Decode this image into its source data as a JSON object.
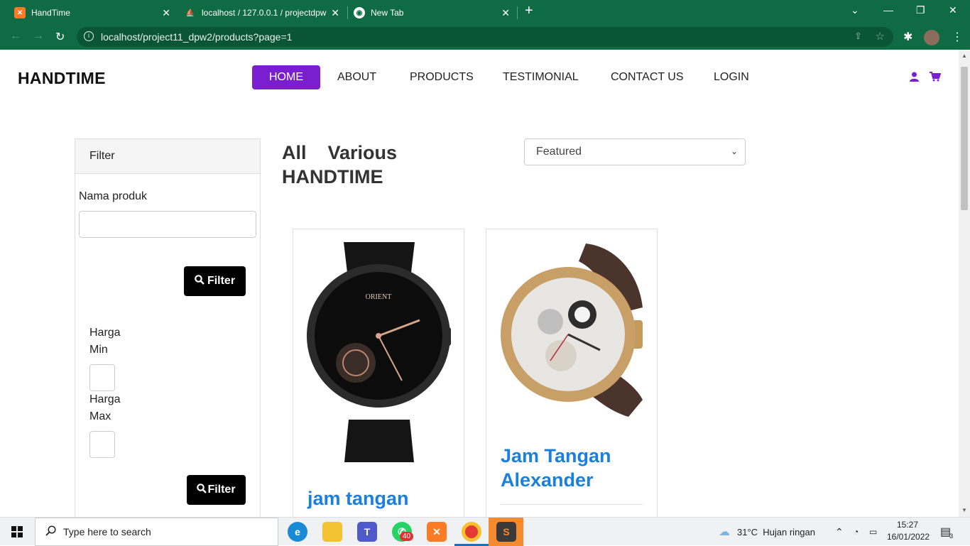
{
  "browser": {
    "tabs": [
      {
        "title": "HandTime",
        "icon": "xampp-icon"
      },
      {
        "title": "localhost / 127.0.0.1 / projectdpw",
        "icon": "phpmyadmin-icon"
      },
      {
        "title": "New Tab",
        "icon": "globe-icon"
      }
    ],
    "new_tab": "+",
    "url": "localhost/project11_dpw2/products?page=1"
  },
  "site": {
    "brand": "HANDTIME",
    "nav": [
      "HOME",
      "ABOUT",
      "PRODUCTS",
      "TESTIMONIAL",
      "CONTACT US",
      "LOGIN"
    ],
    "accent": "#7a1fd0"
  },
  "filter": {
    "title": "Filter",
    "name_label": "Nama produk",
    "name_value": "",
    "filter_button": "Filter",
    "min_label_1": "Harga",
    "min_label_2": "Min",
    "max_label_1": "Harga",
    "max_label_2": "Max",
    "filter_button_2": "Filter"
  },
  "listing": {
    "title_1": "All    Various",
    "title_2": "HANDTIME",
    "sort_selected": "Featured"
  },
  "products": [
    {
      "name": "jam tangan"
    },
    {
      "name_1": "Jam Tangan",
      "name_2": "Alexander"
    }
  ],
  "taskbar": {
    "search_placeholder": "Type here to search",
    "whatsapp_badge": "40",
    "weather": "31°C  Hujan ringan",
    "time": "15:27",
    "date": "16/01/2022",
    "notifications": "3"
  }
}
